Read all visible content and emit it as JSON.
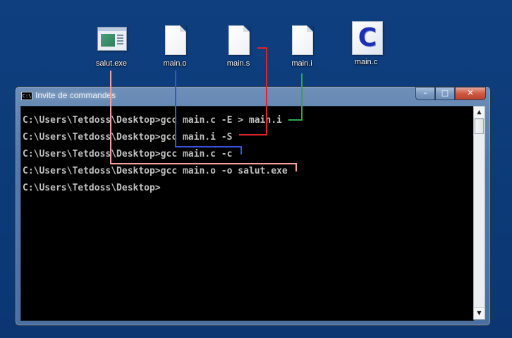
{
  "desktop": {
    "icons": [
      {
        "label": "salut.exe",
        "icon": "exe-window-icon"
      },
      {
        "label": "main.o",
        "icon": "blank-file-icon"
      },
      {
        "label": "main.s",
        "icon": "blank-file-icon"
      },
      {
        "label": "main.i",
        "icon": "blank-file-icon"
      },
      {
        "label": "main.c",
        "icon": "c-source-file-icon"
      }
    ]
  },
  "console": {
    "title": "Invite de commandes",
    "title_icon_text": "C:\\",
    "buttons": {
      "minimize": "–",
      "maximize": "□",
      "close": "✕"
    },
    "lines": [
      "C:\\Users\\Tetdoss\\Desktop>gcc main.c -E > main.i",
      "C:\\Users\\Tetdoss\\Desktop>gcc main.i -S",
      "C:\\Users\\Tetdoss\\Desktop>gcc main.c -c",
      "C:\\Users\\Tetdoss\\Desktop>gcc main.o -o salut.exe",
      "C:\\Users\\Tetdoss\\Desktop>"
    ],
    "scroll": {
      "up": "▲",
      "down": "▼"
    }
  },
  "connectors": {
    "colors": {
      "main_i": "#2ea84a",
      "main_s": "#e0242c",
      "main_o": "#3a4fe6",
      "salut_exe": "#f4a0a0"
    }
  }
}
